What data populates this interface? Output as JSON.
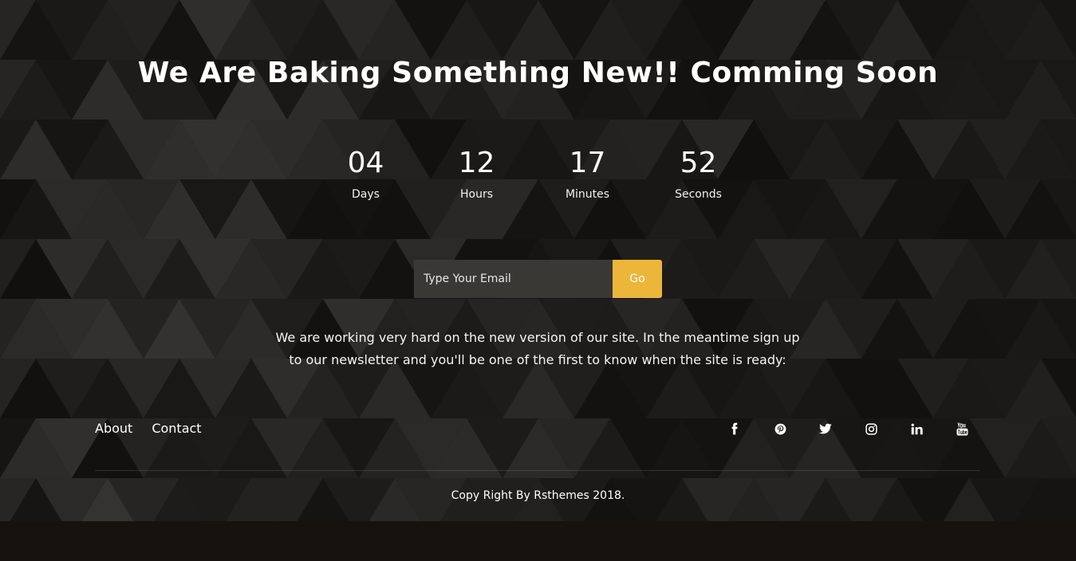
{
  "hero": {
    "headline": "We Are Baking Something New!! Comming Soon"
  },
  "countdown": [
    {
      "value": "04",
      "label": "Days"
    },
    {
      "value": "12",
      "label": "Hours"
    },
    {
      "value": "17",
      "label": "Minutes"
    },
    {
      "value": "52",
      "label": "Seconds"
    }
  ],
  "subscribe": {
    "email_placeholder": "Type Your Email",
    "email_value": "",
    "button_label": "Go"
  },
  "message": {
    "line1": "We are working very hard on the new version of our site. In the meantime sign up",
    "line2": "to our newsletter and you'll be one of the first to know when the site is ready:"
  },
  "footer": {
    "nav": [
      {
        "label": "About"
      },
      {
        "label": "Contact"
      }
    ],
    "social": [
      {
        "icon": "facebook-icon"
      },
      {
        "icon": "pinterest-icon"
      },
      {
        "icon": "twitter-icon"
      },
      {
        "icon": "instagram-icon"
      },
      {
        "icon": "linkedin-icon"
      },
      {
        "icon": "youtube-icon"
      }
    ],
    "copyright": "Copy Right By Rsthemes 2018."
  },
  "colors": {
    "accent": "#ecb63a",
    "background": "#151311",
    "input_background": "#3a3835",
    "text": "#ffffff"
  }
}
